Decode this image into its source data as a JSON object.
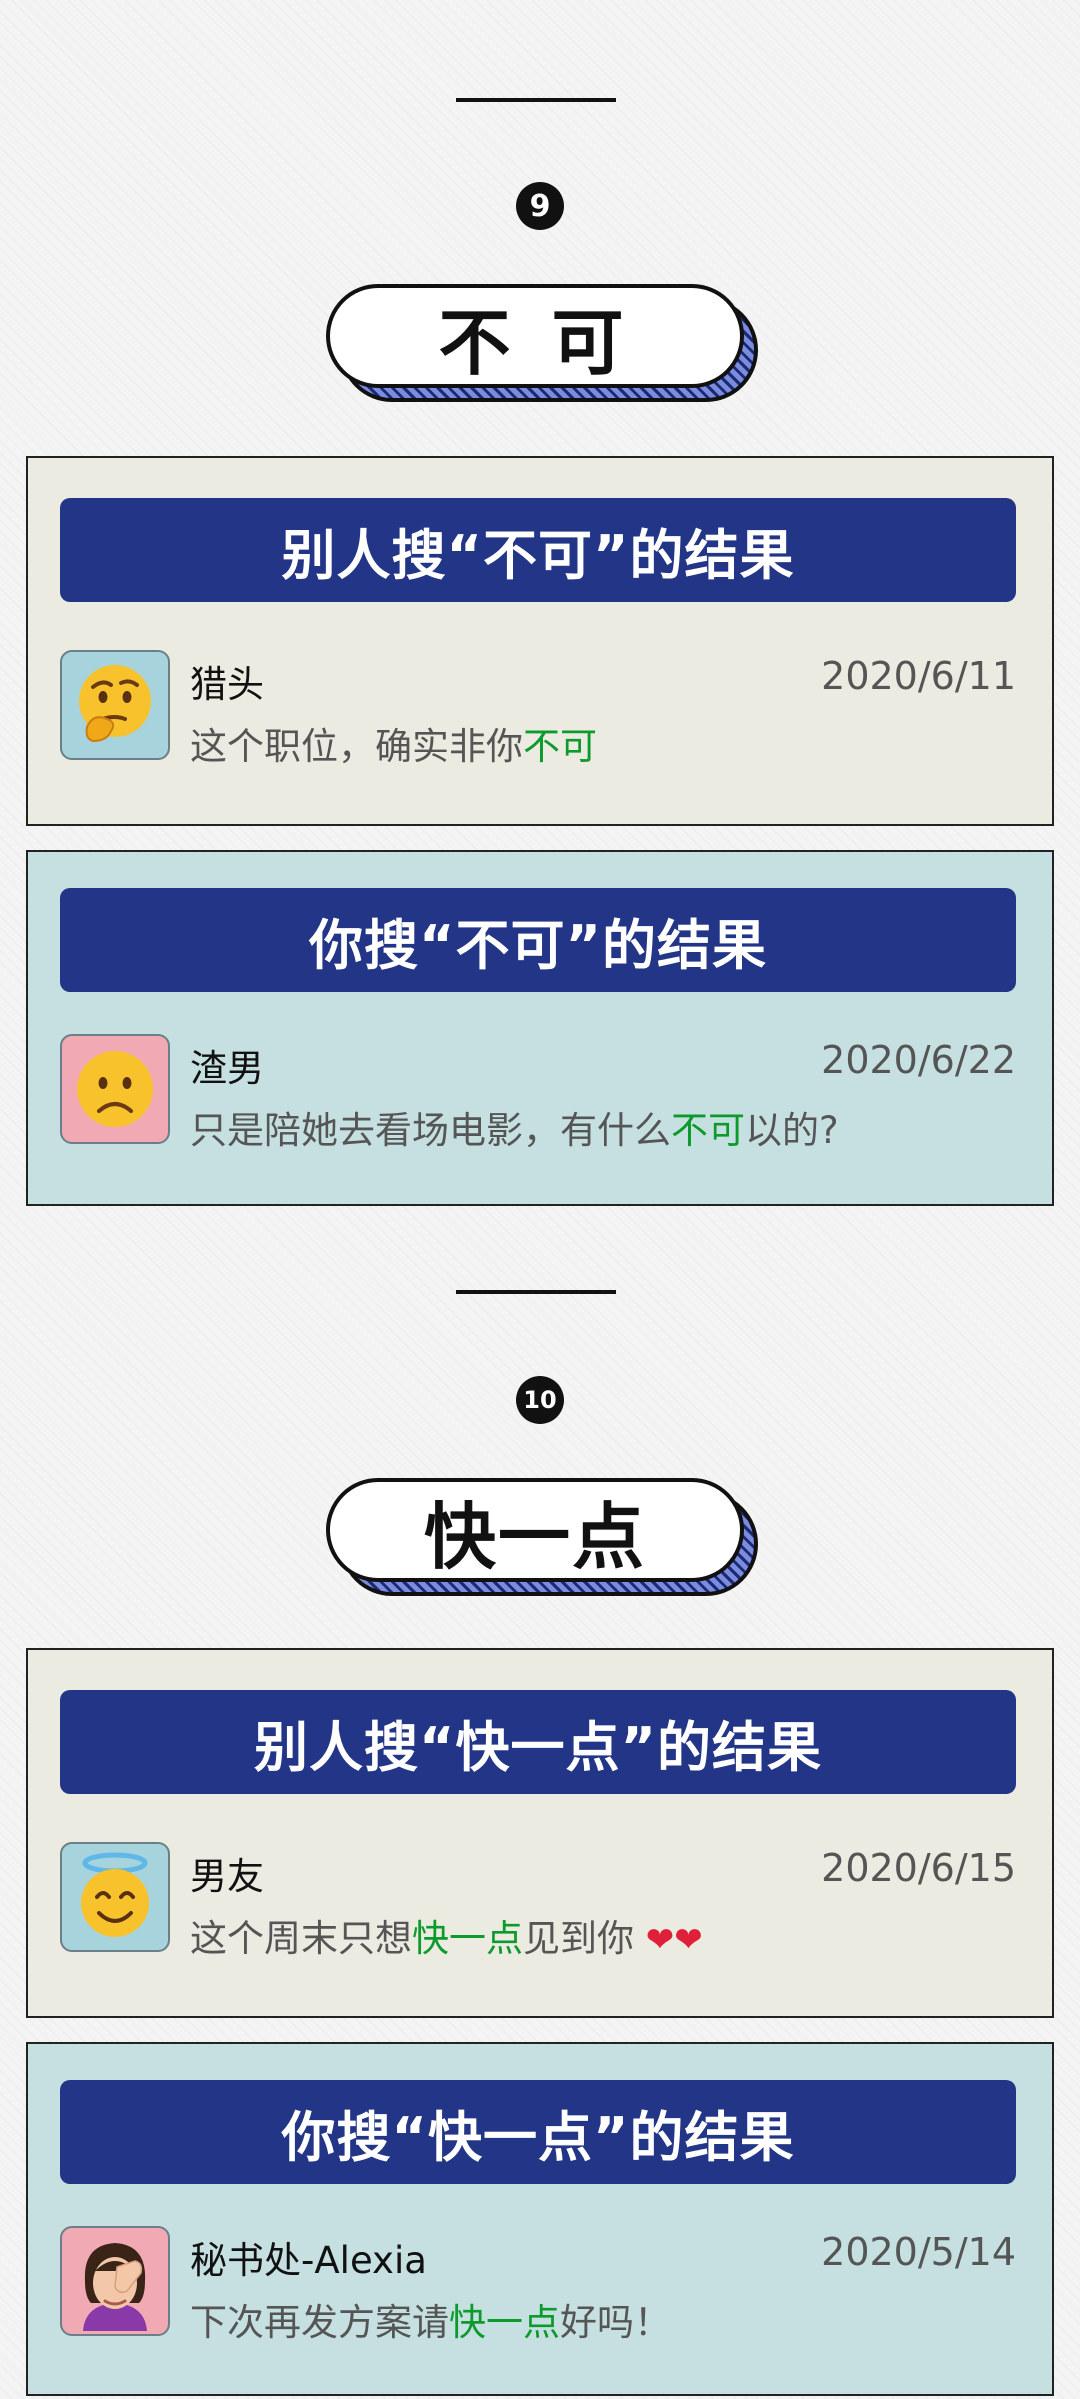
{
  "sections": [
    {
      "number": "9",
      "title": "不 可",
      "cards": [
        {
          "banner": "别人搜“不可”的结果",
          "name": "猎头",
          "date": "2020/6/11",
          "msg_before": "这个职位，确实非你",
          "msg_highlight": "不可",
          "msg_after": ""
        },
        {
          "banner": "你搜“不可”的结果",
          "name": "渣男",
          "date": "2020/6/22",
          "msg_before": "只是陪她去看场电影，有什么",
          "msg_highlight": "不可",
          "msg_after": "以的?"
        }
      ]
    },
    {
      "number": "10",
      "title": "快一点",
      "cards": [
        {
          "banner": "别人搜“快一点”的结果",
          "name": "男友",
          "date": "2020/6/15",
          "msg_before": "这个周末只想",
          "msg_highlight": "快一点",
          "msg_after": "见到你 ",
          "msg_emoji": "❤❤"
        },
        {
          "banner": "你搜“快一点”的结果",
          "name": "秘书处-Alexia",
          "date": "2020/5/14",
          "msg_before": "下次再发方案请",
          "msg_highlight": "快一点",
          "msg_after": "好吗！"
        }
      ]
    }
  ],
  "avatars": [
    "thinking-face",
    "frowning-face",
    "smiling-halo-face",
    "facepalm-woman"
  ],
  "colors": {
    "banner_bg": "#223587",
    "card_beige": "#ecebe1",
    "card_blue": "#c6e0e1",
    "highlight": "#0d9a2c",
    "date": "#555555"
  }
}
